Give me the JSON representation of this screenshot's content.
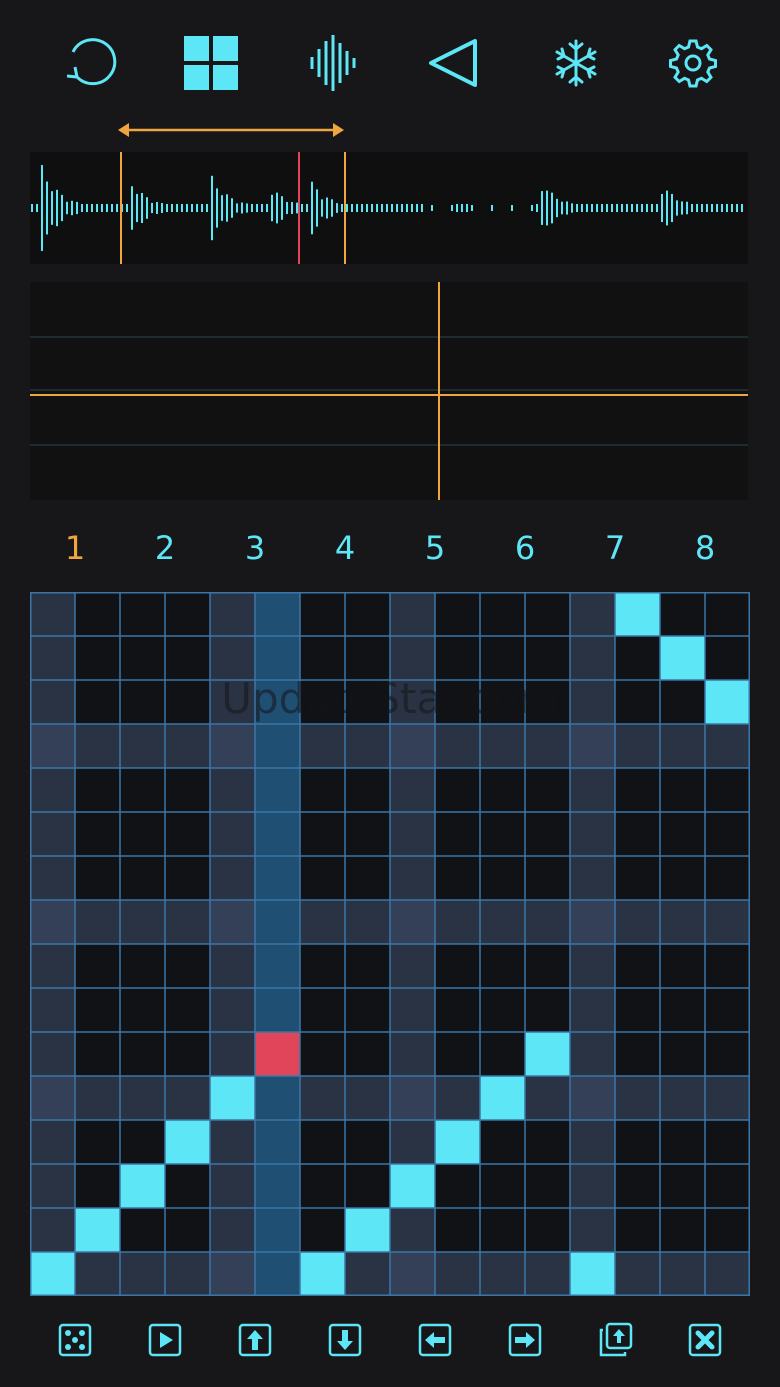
{
  "colors": {
    "accent": "#5de6f6",
    "accent_dim": "#3ab6c8",
    "orange": "#f0a640",
    "playhead": "#e0455a",
    "grid_line": "#3b76a8",
    "cell_dark": "#111215",
    "cell_band": "#2a3344",
    "column_highlight": "#1f4f73"
  },
  "toolbar": {
    "items": [
      {
        "name": "loop-icon"
      },
      {
        "name": "grid-view-icon"
      },
      {
        "name": "waveform-icon"
      },
      {
        "name": "play-reverse-icon"
      },
      {
        "name": "freeze-icon"
      },
      {
        "name": "settings-icon"
      }
    ]
  },
  "steps": {
    "labels": [
      "1",
      "2",
      "3",
      "4",
      "5",
      "6",
      "7",
      "8"
    ],
    "active_label_index": 0
  },
  "sequencer": {
    "columns": 16,
    "rows": 16,
    "highlight_column": 5,
    "band_rows": [
      3,
      7,
      11,
      15
    ],
    "band_columns": [
      0,
      4,
      8,
      12
    ],
    "active_cells": [
      [
        15,
        0
      ],
      [
        14,
        1
      ],
      [
        13,
        2
      ],
      [
        12,
        3
      ],
      [
        11,
        4
      ],
      [
        15,
        6
      ],
      [
        14,
        7
      ],
      [
        13,
        8
      ],
      [
        12,
        9
      ],
      [
        11,
        10
      ],
      [
        10,
        11
      ],
      [
        15,
        12
      ],
      [
        0,
        13
      ],
      [
        1,
        14
      ],
      [
        2,
        15
      ]
    ],
    "playhead_cell": [
      10,
      5
    ]
  },
  "watermark": {
    "text": "UpdateStar.com"
  },
  "bottom_bar": {
    "items": [
      {
        "name": "randomize-dice-icon"
      },
      {
        "name": "play-icon"
      },
      {
        "name": "shift-up-icon"
      },
      {
        "name": "shift-down-icon"
      },
      {
        "name": "shift-left-icon"
      },
      {
        "name": "shift-right-icon"
      },
      {
        "name": "duplicate-icon"
      },
      {
        "name": "clear-icon"
      }
    ]
  }
}
